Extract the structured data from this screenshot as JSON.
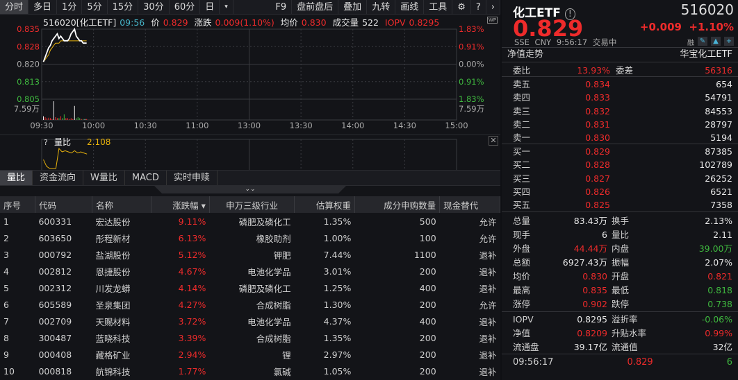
{
  "toolbar": {
    "left": [
      "分时",
      "多日",
      "1分",
      "5分",
      "15分",
      "30分",
      "60分",
      "日",
      "▾"
    ],
    "right": [
      "F9",
      "盘前盘后",
      "叠加",
      "九转",
      "画线",
      "工具"
    ],
    "gear": "⚙",
    "help": "?",
    "more": "›"
  },
  "info": {
    "name": "516020[化工ETF]",
    "time": "09:56",
    "price_label": "价",
    "price": "0.829",
    "chg_label": "涨跌",
    "chg": "0.009(1.10%)",
    "avg_label": "均价",
    "avg": "0.830",
    "vol_label": "成交量",
    "vol": "522",
    "iopv_label": "IOPV",
    "iopv": "0.8295",
    "wp": "WP"
  },
  "chart_data": {
    "type": "line",
    "title": "516020 分时",
    "y_ticks_left": [
      "0.835",
      "0.828",
      "0.820",
      "0.813",
      "0.805"
    ],
    "y_ticks_right": [
      "1.83%",
      "0.91%",
      "0.00%",
      "0.91%",
      "1.83%"
    ],
    "vol_label": "7.59万",
    "x_ticks": [
      "09:30",
      "10:00",
      "10:30",
      "11:00",
      "13:00",
      "13:30",
      "14:00",
      "14:30",
      "15:00"
    ],
    "ylim": [
      0.805,
      0.835
    ],
    "prev_close": 0.82,
    "price": [
      0.821,
      0.823,
      0.825,
      0.827,
      0.828,
      0.83,
      0.831,
      0.832,
      0.833,
      0.831,
      0.832,
      0.831,
      0.83,
      0.83,
      0.83,
      0.831,
      0.833,
      0.834,
      0.835,
      0.832,
      0.831,
      0.83,
      0.83,
      0.829,
      0.829,
      0.829
    ],
    "avg": [
      0.821,
      0.822,
      0.823,
      0.824,
      0.826,
      0.827,
      0.828,
      0.829,
      0.829,
      0.829,
      0.83,
      0.83,
      0.83,
      0.83,
      0.83,
      0.83,
      0.83,
      0.83,
      0.83,
      0.83,
      0.83,
      0.83,
      0.83,
      0.83,
      0.83,
      0.83
    ],
    "volume": [
      0.2,
      0.15,
      0.1,
      0.12,
      0.1,
      0.05,
      1.0,
      0.15,
      0.1,
      0.1,
      0.2,
      0.1,
      0.3,
      0.1,
      0.1,
      0.05,
      0.1,
      0.05,
      0.75,
      0.1,
      0.15,
      0.1,
      0.05,
      0.05,
      0.05,
      0.05
    ],
    "ratio_label": "量比",
    "ratio_value": "2.108",
    "ratio": [
      1.8,
      1.2,
      1.0,
      1.0,
      1.0,
      2.8,
      2.5,
      2.6,
      2.5,
      2.4,
      2.6,
      2.4,
      2.5,
      2.4,
      2.3
    ]
  },
  "tabs": [
    "量比",
    "资金流向",
    "W量比",
    "MACD",
    "实时申赎"
  ],
  "table": {
    "headers": [
      "序号",
      "代码",
      "名称",
      "涨跌幅 ▾",
      "申万三级行业",
      "估算权重",
      "成分申购数量",
      "现金替代"
    ],
    "rows": [
      [
        "1",
        "600331",
        "宏达股份",
        "9.11%",
        "磷肥及磷化工",
        "1.35%",
        "500",
        "允许"
      ],
      [
        "2",
        "603650",
        "彤程新材",
        "6.13%",
        "橡胶助剂",
        "1.00%",
        "100",
        "允许"
      ],
      [
        "3",
        "000792",
        "盐湖股份",
        "5.12%",
        "钾肥",
        "7.44%",
        "1100",
        "退补"
      ],
      [
        "4",
        "002812",
        "恩捷股份",
        "4.67%",
        "电池化学品",
        "3.01%",
        "200",
        "退补"
      ],
      [
        "5",
        "002312",
        "川发龙蟒",
        "4.14%",
        "磷肥及磷化工",
        "1.25%",
        "400",
        "退补"
      ],
      [
        "6",
        "605589",
        "圣泉集团",
        "4.27%",
        "合成树脂",
        "1.30%",
        "200",
        "允许"
      ],
      [
        "7",
        "002709",
        "天赐材料",
        "3.72%",
        "电池化学品",
        "4.37%",
        "400",
        "退补"
      ],
      [
        "8",
        "300487",
        "蓝晓科技",
        "3.39%",
        "合成树脂",
        "1.35%",
        "200",
        "退补"
      ],
      [
        "9",
        "000408",
        "藏格矿业",
        "2.94%",
        "锂",
        "2.97%",
        "200",
        "退补"
      ],
      [
        "10",
        "000818",
        "航锦科技",
        "1.77%",
        "氯碱",
        "1.05%",
        "200",
        "退补"
      ]
    ]
  },
  "quote": {
    "name": "化工ETF",
    "code": "516020",
    "price": "0.829",
    "chg": "+0.009",
    "pct": "+1.10%",
    "sub": "SSE CNY 9:56:17 交易中",
    "rong": "融",
    "nav_trend": "净值走势",
    "fund": "华宝化工ETF",
    "weibi_label": "委比",
    "weibi": "13.93%",
    "weicha_label": "委差",
    "weicha": "56316",
    "asks": [
      [
        "卖五",
        "0.834",
        "654"
      ],
      [
        "卖四",
        "0.833",
        "54791"
      ],
      [
        "卖三",
        "0.832",
        "84553"
      ],
      [
        "卖二",
        "0.831",
        "28797"
      ],
      [
        "卖一",
        "0.830",
        "5194"
      ]
    ],
    "bids": [
      [
        "买一",
        "0.829",
        "87385"
      ],
      [
        "买二",
        "0.828",
        "102789"
      ],
      [
        "买三",
        "0.827",
        "26252"
      ],
      [
        "买四",
        "0.826",
        "6521"
      ],
      [
        "买五",
        "0.825",
        "7358"
      ]
    ],
    "stats": [
      [
        "总量",
        "83.43万",
        "换手",
        "2.13%"
      ],
      [
        "现手",
        "6",
        "量比",
        "2.11"
      ],
      [
        "外盘",
        "44.44万",
        "内盘",
        "39.00万"
      ],
      [
        "总额",
        "6927.43万",
        "振幅",
        "2.07%"
      ],
      [
        "均价",
        "0.830",
        "开盘",
        "0.821"
      ],
      [
        "最高",
        "0.835",
        "最低",
        "0.818"
      ],
      [
        "涨停",
        "0.902",
        "跌停",
        "0.738"
      ]
    ],
    "nav": [
      [
        "IOPV",
        "0.8295",
        "溢折率",
        "-0.06%"
      ],
      [
        "净值",
        "0.8209",
        "升贴水率",
        "0.99%"
      ],
      [
        "流通盘",
        "39.17亿",
        "流通值",
        "32亿"
      ]
    ],
    "tick": {
      "time": "09:56:17",
      "price": "0.829",
      "vol": "6"
    }
  }
}
